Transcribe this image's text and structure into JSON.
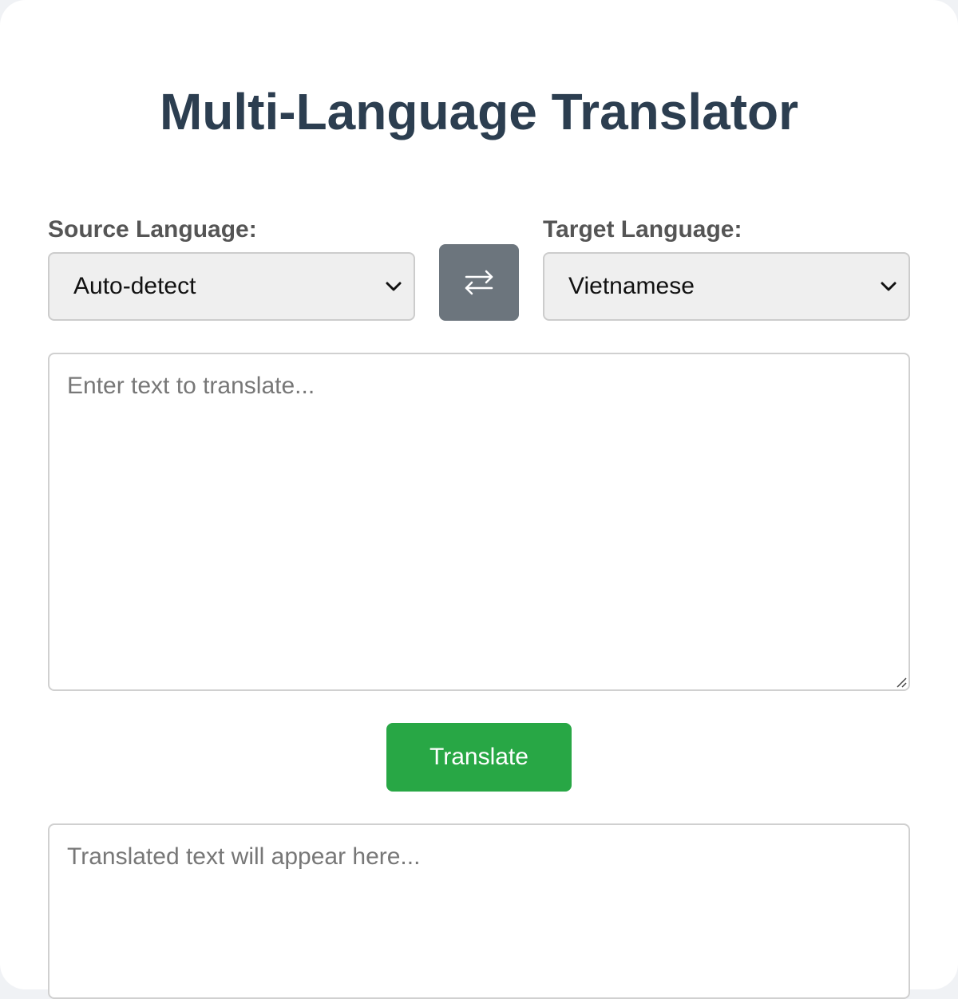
{
  "app": {
    "title": "Multi-Language Translator"
  },
  "source": {
    "label": "Source Language:",
    "selected": "Auto-detect"
  },
  "target": {
    "label": "Target Language:",
    "selected": "Vietnamese"
  },
  "swap": {
    "icon": "swap-arrows-icon"
  },
  "input": {
    "placeholder": "Enter text to translate...",
    "value": ""
  },
  "translate_button": {
    "label": "Translate"
  },
  "output": {
    "placeholder": "Translated text will appear here...",
    "value": ""
  },
  "colors": {
    "title": "#2c3e50",
    "swap_button": "#6c757d",
    "translate_button": "#28a745"
  }
}
